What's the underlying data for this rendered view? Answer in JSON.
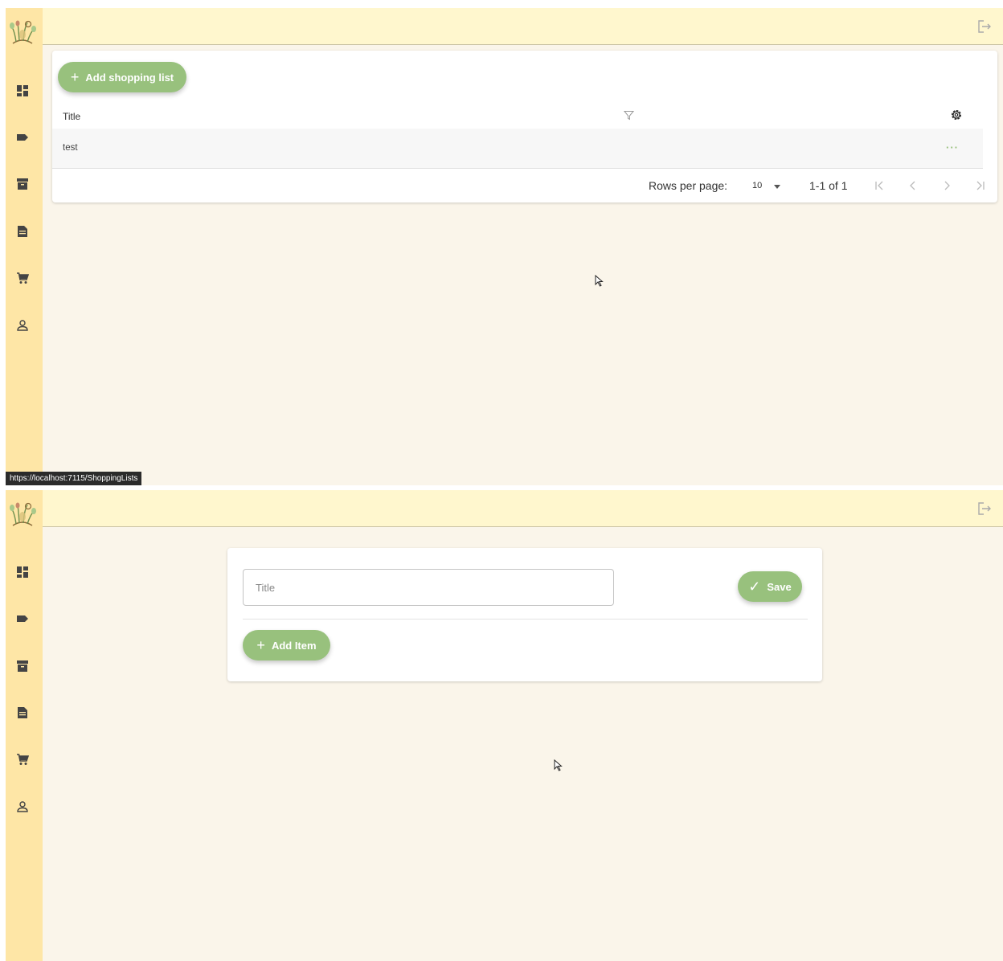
{
  "screens": [
    {
      "add_button": {
        "label": "Add shopping list",
        "glyph": "+"
      },
      "table": {
        "columns": {
          "title": "Title"
        },
        "rows": [
          {
            "title": "test",
            "actions": "···"
          }
        ]
      },
      "pagination": {
        "rows_per_page_label": "Rows per page:",
        "rows_per_page_value": "10",
        "range": "1-1 of 1"
      },
      "status_url": "https://localhost:7115/ShoppingLists"
    },
    {
      "form": {
        "title_placeholder": "Title",
        "save_label": "Save",
        "save_glyph": "✓",
        "add_item_label": "Add Item",
        "add_item_glyph": "+"
      }
    }
  ],
  "sidebar_icons": [
    "dashboard-icon",
    "label-icon",
    "archive-icon",
    "document-icon",
    "cart-icon",
    "person-icon"
  ],
  "colors": {
    "sidebar": "#fee6a6",
    "topbar": "#fff7ce",
    "background": "#faf5ea",
    "accent_green": "#98c17d"
  }
}
